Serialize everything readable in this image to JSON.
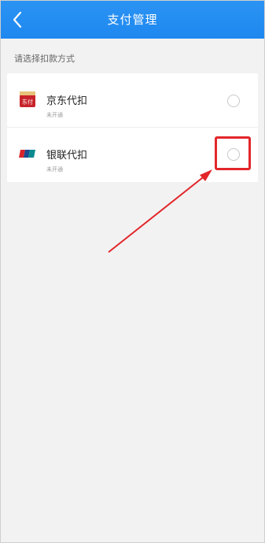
{
  "header": {
    "title": "支付管理"
  },
  "section": {
    "label": "请选择扣款方式"
  },
  "methods": [
    {
      "name": "京东代扣",
      "status": "未开通",
      "logo_text": "东付",
      "icon": "jd-pay-logo-icon",
      "selected": false
    },
    {
      "name": "银联代扣",
      "status": "未开通",
      "icon": "unionpay-logo-icon",
      "selected": false
    }
  ],
  "colors": {
    "header_bg": "#1e88f0",
    "annotation": "#e2262a",
    "page_bg": "#f2f2f2"
  }
}
